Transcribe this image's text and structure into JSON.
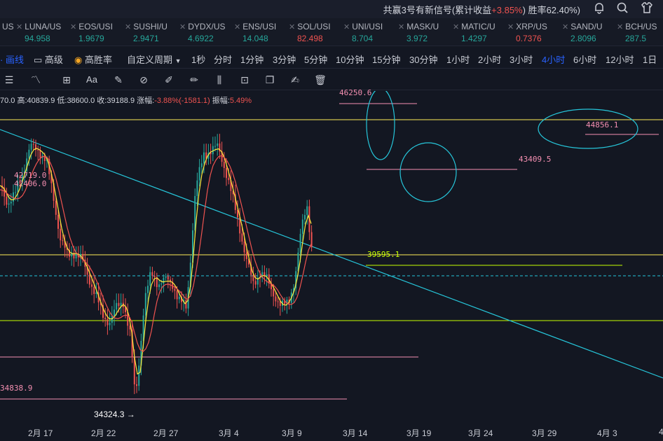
{
  "header": {
    "signal_text": "共赢3号有新信号(累计收益",
    "signal_return": "+3.85%",
    "signal_close": ")",
    "win_rate": "胜率62.40%)",
    "icons": [
      "bell-icon",
      "search-icon",
      "shirt-icon"
    ]
  },
  "tickers": [
    {
      "symbol": "USI",
      "price": "",
      "dir": "none"
    },
    {
      "symbol": "LUNA/US",
      "price": "94.958",
      "dir": "up"
    },
    {
      "symbol": "EOS/USI",
      "price": "1.9679",
      "dir": "up"
    },
    {
      "symbol": "SUSHI/U",
      "price": "2.9471",
      "dir": "up"
    },
    {
      "symbol": "DYDX/US",
      "price": "4.6922",
      "dir": "up"
    },
    {
      "symbol": "ENS/USI",
      "price": "14.048",
      "dir": "up"
    },
    {
      "symbol": "SOL/USI",
      "price": "82.498",
      "dir": "down"
    },
    {
      "symbol": "UNI/USI",
      "price": "8.704",
      "dir": "up"
    },
    {
      "symbol": "MASK/U",
      "price": "3.972",
      "dir": "up"
    },
    {
      "symbol": "MATIC/U",
      "price": "1.4297",
      "dir": "up"
    },
    {
      "symbol": "XRP/US",
      "price": "0.7376",
      "dir": "down"
    },
    {
      "symbol": "SAND/U",
      "price": "2.8096",
      "dir": "up"
    },
    {
      "symbol": "BCH/US",
      "price": "287.5",
      "dir": "up"
    }
  ],
  "periods": {
    "draw_line": "画线",
    "advanced": "高级",
    "high_win": "高胜率",
    "custom": "自定义周期",
    "items": [
      "1秒",
      "分时",
      "1分钟",
      "3分钟",
      "5分钟",
      "10分钟",
      "15分钟",
      "30分钟",
      "1小时",
      "2小时",
      "3小时",
      "4小时",
      "6小时",
      "12小时",
      "1日"
    ],
    "active": "4小时"
  },
  "ohlc": {
    "open": "70.0",
    "high_label": "高:",
    "high": "40839.9",
    "low_label": "低:",
    "low": "38600.0",
    "close_label": "收:",
    "close": "39188.9",
    "change_label": "涨幅:",
    "change": "-3.88%(-1581.1)",
    "amp_label": "振幅:",
    "amp": "5.49%"
  },
  "price_labels": [
    {
      "text": "46250.6",
      "color": "#f48fb1"
    },
    {
      "text": "44856.1",
      "color": "#f48fb1"
    },
    {
      "text": "43409.5",
      "color": "#f48fb1"
    },
    {
      "text": "42719.0",
      "color": "#f48fb1"
    },
    {
      "text": "42406.0",
      "color": "#f48fb1"
    },
    {
      "text": "39595.1",
      "color": "#c6ff00"
    },
    {
      "text": "34838.9",
      "color": "#f48fb1"
    },
    {
      "text": "34324.3 →",
      "color": "#ffffff"
    }
  ],
  "xaxis": [
    "2月 17",
    "2月 22",
    "2月 27",
    "3月 4",
    "3月 9",
    "3月 14",
    "3月 19",
    "3月 24",
    "3月 29",
    "4月 3",
    "4"
  ],
  "colors": {
    "up": "#26a69a",
    "down": "#ef5350",
    "accent": "#2962ff",
    "trend": "#26c6da",
    "ma_fast": "#ffeb3b",
    "ma_slow": "#ef5350",
    "level_yellow": "#ffee58",
    "level_pink": "#f48fb1",
    "level_lime": "#c6ff00"
  }
}
